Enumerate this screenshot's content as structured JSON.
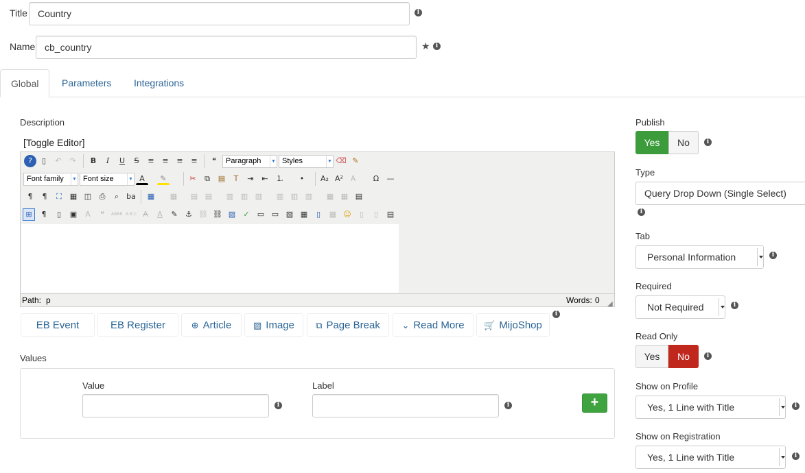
{
  "form": {
    "title_label": "Title",
    "title_value": "Country",
    "name_label": "Name",
    "name_value": "cb_country"
  },
  "tabs": [
    {
      "label": "Global"
    },
    {
      "label": "Parameters"
    },
    {
      "label": "Integrations"
    }
  ],
  "description": {
    "label": "Description",
    "toggle_editor": "[Toggle Editor]",
    "format_select": "Paragraph",
    "styles_select": "Styles",
    "font_family_select": "Font family",
    "font_size_select": "Font size",
    "path_label": "Path:",
    "path_value": "p",
    "words_label": "Words:",
    "words_value": "0"
  },
  "editor_buttons": [
    {
      "label": "EB Event",
      "icon": "none"
    },
    {
      "label": "EB Register",
      "icon": "none"
    },
    {
      "label": "Article",
      "icon": "article-icon"
    },
    {
      "label": "Image",
      "icon": "image-icon"
    },
    {
      "label": "Page Break",
      "icon": "copy-icon"
    },
    {
      "label": "Read More",
      "icon": "chevron-down-icon"
    },
    {
      "label": "MijoShop",
      "icon": "cart-icon"
    }
  ],
  "values": {
    "section_label": "Values",
    "value_label": "Value",
    "label_label": "Label",
    "add_label": "+"
  },
  "right": {
    "publish_label": "Publish",
    "publish_yes": "Yes",
    "publish_no": "No",
    "type_label": "Type",
    "type_value": "Query Drop Down (Single Select)",
    "tab_label": "Tab",
    "tab_value": "Personal Information",
    "required_label": "Required",
    "required_value": "Not Required",
    "readonly_label": "Read Only",
    "readonly_yes": "Yes",
    "readonly_no": "No",
    "show_profile_label": "Show on Profile",
    "show_profile_value": "Yes, 1 Line with Title",
    "show_registration_label": "Show on Registration",
    "show_registration_value": "Yes, 1 Line with Title"
  },
  "colors": {
    "link": "#2a6496",
    "yes_active": "#3c9c3c",
    "no_active": "#c0281e",
    "add_button": "#3fa33f"
  }
}
